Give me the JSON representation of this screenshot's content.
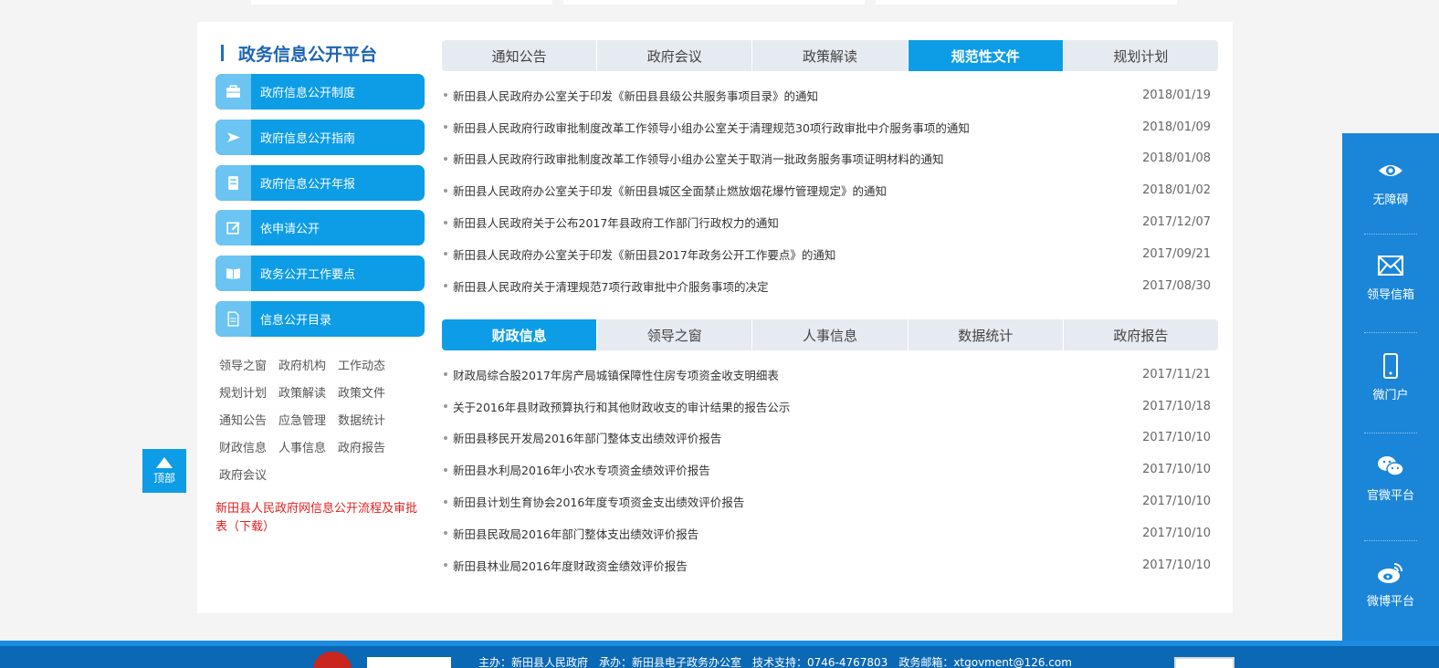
{
  "platform_title": "政务信息公开平台",
  "menu": [
    {
      "label": "政府信息公开制度",
      "icon": "briefcase-icon"
    },
    {
      "label": "政府信息公开指南",
      "icon": "paper-plane-icon"
    },
    {
      "label": "政府信息公开年报",
      "icon": "report-book-icon"
    },
    {
      "label": "依申请公开",
      "icon": "edit-icon"
    },
    {
      "label": "政务公开工作要点",
      "icon": "open-book-icon"
    },
    {
      "label": "信息公开目录",
      "icon": "document-icon"
    }
  ],
  "categories": [
    [
      "领导之窗",
      "政府机构",
      "工作动态"
    ],
    [
      "规划计划",
      "政策解读",
      "政策文件"
    ],
    [
      "通知公告",
      "应急管理",
      "数据统计"
    ],
    [
      "财政信息",
      "人事信息",
      "政府报告"
    ],
    [
      "政府会议"
    ]
  ],
  "download_link": "新田县人民政府网信息公开流程及审批表（下载）",
  "tabs1": {
    "tabs": [
      "通知公告",
      "政府会议",
      "政策解读",
      "规范性文件",
      "规划计划"
    ],
    "active": "规范性文件",
    "items": [
      {
        "title": "新田县人民政府办公室关于印发《新田县县级公共服务事项目录》的通知",
        "date": "2018/01/19"
      },
      {
        "title": "新田县人民政府行政审批制度改革工作领导小组办公室关于清理规范30项行政审批中介服务事项的通知",
        "date": "2018/01/09"
      },
      {
        "title": "新田县人民政府行政审批制度改革工作领导小组办公室关于取消一批政务服务事项证明材料的通知",
        "date": "2018/01/08"
      },
      {
        "title": "新田县人民政府办公室关于印发《新田县城区全面禁止燃放烟花爆竹管理规定》的通知",
        "date": "2018/01/02"
      },
      {
        "title": "新田县人民政府关于公布2017年县政府工作部门行政权力的通知",
        "date": "2017/12/07"
      },
      {
        "title": "新田县人民政府办公室关于印发《新田县2017年政务公开工作要点》的通知",
        "date": "2017/09/21"
      },
      {
        "title": "新田县人民政府关于清理规范7项行政审批中介服务事项的决定",
        "date": "2017/08/30"
      }
    ]
  },
  "tabs2": {
    "tabs": [
      "财政信息",
      "领导之窗",
      "人事信息",
      "数据统计",
      "政府报告"
    ],
    "active": "财政信息",
    "items": [
      {
        "title": "财政局综合股2017年房产局城镇保障性住房专项资金收支明细表",
        "date": "2017/11/21"
      },
      {
        "title": "关于2016年县财政预算执行和其他财政收支的审计结果的报告公示",
        "date": "2017/10/18"
      },
      {
        "title": "新田县移民开发局2016年部门整体支出绩效评价报告",
        "date": "2017/10/10"
      },
      {
        "title": "新田县水利局2016年小农水专项资金绩效评价报告",
        "date": "2017/10/10"
      },
      {
        "title": "新田县计划生育协会2016年度专项资金支出绩效评价报告",
        "date": "2017/10/10"
      },
      {
        "title": "新田县民政局2016年部门整体支出绩效评价报告",
        "date": "2017/10/10"
      },
      {
        "title": "新田县林业局2016年度财政资金绩效评价报告",
        "date": "2017/10/10"
      }
    ]
  },
  "to_top_label": "顶部",
  "sidebar": [
    {
      "label": "无障碍",
      "icon": "eye-icon"
    },
    {
      "label": "领导信箱",
      "icon": "mail-icon"
    },
    {
      "label": "微门户",
      "icon": "mobile-phone-icon"
    },
    {
      "label": "官微平台",
      "icon": "wechat-icon"
    },
    {
      "label": "微博平台",
      "icon": "weibo-icon"
    }
  ],
  "footer": {
    "info": "主办：新田县人民政府　承办：新田县电子政务办公室　技术支持：0746-4767803　政务邮箱：xtgovment@126.com"
  },
  "colors": {
    "accent": "#0d9de6",
    "sidebar": "#1b86d8",
    "footer": "#0a68b4",
    "title": "#1c64b4",
    "link_red": "#e02020"
  }
}
